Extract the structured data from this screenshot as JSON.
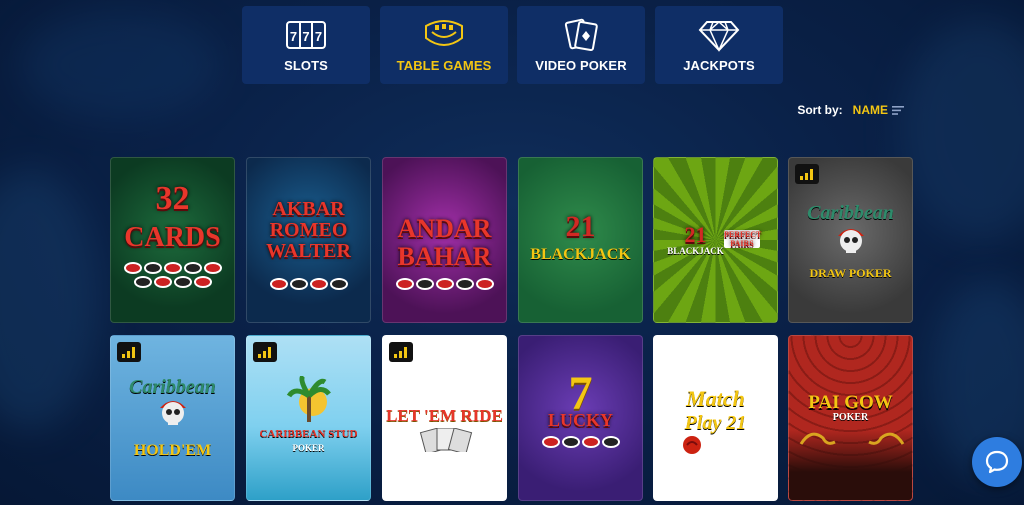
{
  "nav": {
    "tabs": [
      {
        "label": "SLOTS",
        "icon": "slot-machine-icon"
      },
      {
        "label": "TABLE GAMES",
        "icon": "table-games-icon",
        "active": true
      },
      {
        "label": "VIDEO POKER",
        "icon": "playing-cards-icon"
      },
      {
        "label": "JACKPOTS",
        "icon": "diamond-icon"
      }
    ]
  },
  "sort": {
    "label": "Sort by:",
    "value": "NAME"
  },
  "games": [
    {
      "title_line1": "32",
      "title_line2": "CARDS"
    },
    {
      "title_line1": "AKBAR",
      "title_line2": "ROMEO",
      "title_line3": "WALTER"
    },
    {
      "title_line1": "ANDAR",
      "title_line2": "BAHAR"
    },
    {
      "title_line1": "21",
      "title_line2": "BLACKJACK"
    },
    {
      "title_line1": "21",
      "title_line2": "BLACKJACK",
      "extra": "PERFECT PAIRS"
    },
    {
      "title_line1": "Caribbean",
      "title_line2": "DRAW POKER",
      "badge": true
    },
    {
      "title_line1": "Caribbean",
      "title_line2": "HOLD'EM",
      "badge": true
    },
    {
      "title_line1": "CARIBBEAN STUD",
      "title_line2": "POKER",
      "badge": true
    },
    {
      "title_line1": "LET 'EM RIDE",
      "badge": true
    },
    {
      "title_line1": "7",
      "title_line2": "LUCKY"
    },
    {
      "title_line1": "Match",
      "title_line2": "Play 21"
    },
    {
      "title_line1": "PAI GOW",
      "title_line2": "POKER"
    }
  ],
  "colors": {
    "accent": "#f3c613",
    "tab_bg": "#0f2e66",
    "chat": "#2e7de0"
  }
}
